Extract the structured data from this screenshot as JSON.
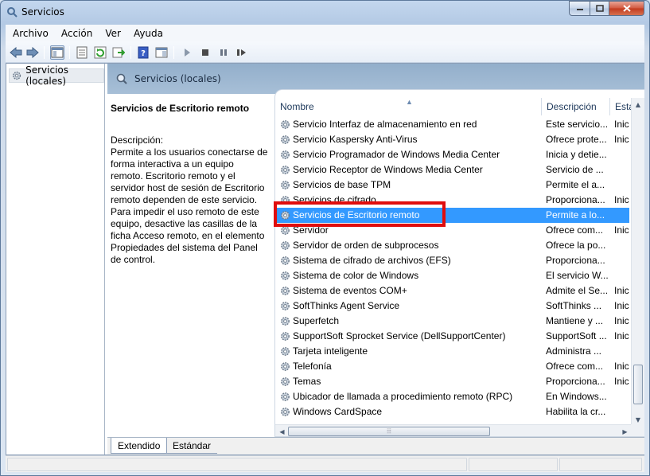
{
  "window": {
    "title": "Servicios"
  },
  "menu": [
    {
      "label": "Archivo"
    },
    {
      "label": "Acción"
    },
    {
      "label": "Ver"
    },
    {
      "label": "Ayuda"
    }
  ],
  "tree": {
    "root_label": "Servicios (locales)"
  },
  "content": {
    "header_label": "Servicios (locales)",
    "selected_service_title": "Servicios de Escritorio remoto",
    "description_label": "Descripción:",
    "description_text": "Permite a los usuarios conectarse de forma interactiva a un equipo remoto. Escritorio remoto y el servidor host de sesión de Escritorio remoto dependen de este servicio. Para impedir el uso remoto de este equipo, desactive las casillas de la ficha Acceso remoto, en el elemento Propiedades del sistema del Panel de control."
  },
  "list": {
    "columns": [
      "Nombre",
      "Descripción",
      "Esta"
    ],
    "rows": [
      {
        "name": "Servicio Interfaz de almacenamiento en red",
        "desc": "Este servicio...",
        "state": "Inic"
      },
      {
        "name": "Servicio Kaspersky Anti-Virus",
        "desc": "Ofrece prote...",
        "state": "Inic"
      },
      {
        "name": "Servicio Programador de Windows Media Center",
        "desc": "Inicia y detie...",
        "state": ""
      },
      {
        "name": "Servicio Receptor de Windows Media Center",
        "desc": "Servicio de ...",
        "state": ""
      },
      {
        "name": "Servicios de base TPM",
        "desc": "Permite el a...",
        "state": ""
      },
      {
        "name": "Servicios de cifrado",
        "desc": "Proporciona...",
        "state": "Inic"
      },
      {
        "name": "Servicios de Escritorio remoto",
        "desc": "Permite a lo...",
        "state": "",
        "selected": true
      },
      {
        "name": "Servidor",
        "desc": "Ofrece com...",
        "state": "Inic"
      },
      {
        "name": "Servidor de orden de subprocesos",
        "desc": "Ofrece la po...",
        "state": ""
      },
      {
        "name": "Sistema de cifrado de archivos (EFS)",
        "desc": "Proporciona...",
        "state": ""
      },
      {
        "name": "Sistema de color de Windows",
        "desc": "El servicio W...",
        "state": ""
      },
      {
        "name": "Sistema de eventos COM+",
        "desc": "Admite el Se...",
        "state": "Inic"
      },
      {
        "name": "SoftThinks Agent Service",
        "desc": "SoftThinks ...",
        "state": "Inic"
      },
      {
        "name": "Superfetch",
        "desc": "Mantiene y ...",
        "state": "Inic"
      },
      {
        "name": "SupportSoft Sprocket Service (DellSupportCenter)",
        "desc": "SupportSoft ...",
        "state": "Inic"
      },
      {
        "name": "Tarjeta inteligente",
        "desc": "Administra ...",
        "state": ""
      },
      {
        "name": "Telefonía",
        "desc": "Ofrece com...",
        "state": "Inic"
      },
      {
        "name": "Temas",
        "desc": "Proporciona...",
        "state": "Inic"
      },
      {
        "name": "Ubicador de llamada a procedimiento remoto (RPC)",
        "desc": "En Windows...",
        "state": ""
      },
      {
        "name": "Windows CardSpace",
        "desc": "Habilita la cr...",
        "state": ""
      }
    ]
  },
  "tabs": [
    {
      "label": "Extendido"
    },
    {
      "label": "Estándar"
    }
  ],
  "colors": {
    "selection": "#3399ff",
    "highlight_box": "#e00d0d"
  },
  "icons": {
    "toolbar": [
      "back-arrow-icon",
      "forward-arrow-icon",
      "console-tree-icon",
      "properties-icon",
      "refresh-icon",
      "export-list-icon",
      "help-icon",
      "show-hide-pane-icon",
      "play-icon",
      "stop-icon",
      "pause-icon",
      "restart-icon"
    ],
    "service": "gear-icon"
  }
}
